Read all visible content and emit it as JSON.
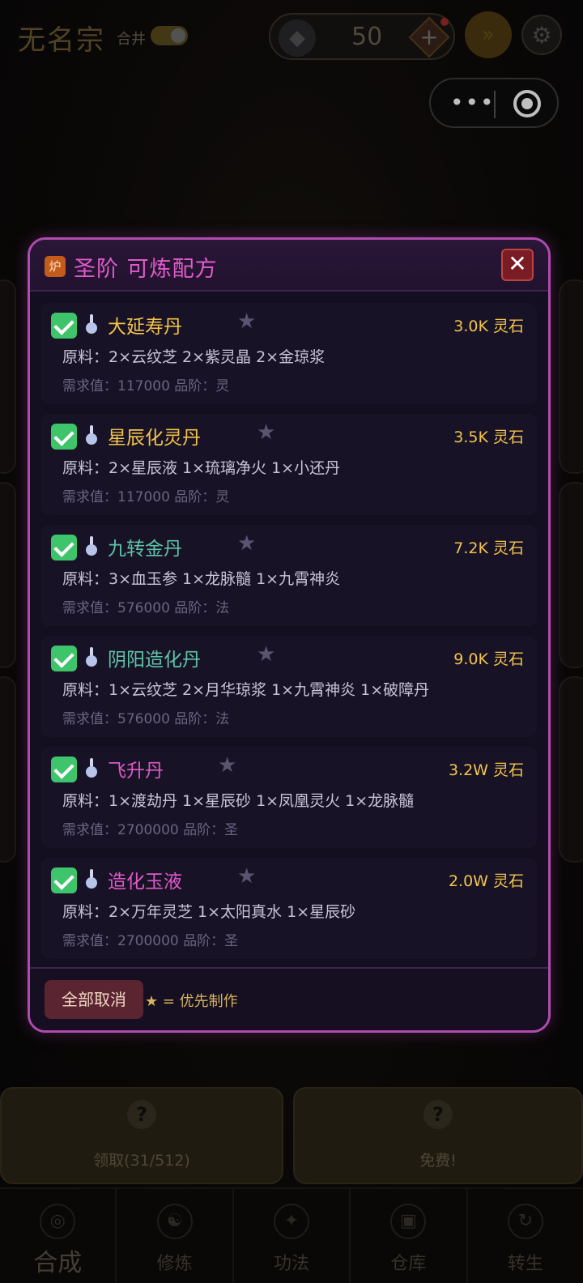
{
  "app": {
    "title": "无名宗",
    "merge_label": "合井",
    "currency_amount": "50",
    "plus_label": "+",
    "speed_icon": "»",
    "gear_icon": "⚙"
  },
  "capsule": {
    "more": "•••"
  },
  "bottom_cards": [
    {
      "label": "领取(31/512)"
    },
    {
      "label": "免费!"
    }
  ],
  "navbar": [
    {
      "label": "合成",
      "active": true
    },
    {
      "label": "修炼"
    },
    {
      "label": "功法"
    },
    {
      "label": "仓库"
    },
    {
      "label": "转生"
    }
  ],
  "modal": {
    "icon_text": "炉",
    "title": "圣阶 可炼配方",
    "close": "✕",
    "recipes": [
      {
        "name": "大延寿丹",
        "name_color": "#f2c44a",
        "price": "3.0K 灵石",
        "materials": "原料：2×云纹芝  2×紫灵晶  2×金琼浆",
        "meta": "需求值：117000  品阶：灵",
        "checked": true
      },
      {
        "name": "星辰化灵丹",
        "name_color": "#f2c44a",
        "price": "3.5K 灵石",
        "materials": "原料：2×星辰液  1×琉璃净火  1×小还丹",
        "meta": "需求值：117000  品阶：灵",
        "checked": true
      },
      {
        "name": "九转金丹",
        "name_color": "#5ec4a8",
        "price": "7.2K 灵石",
        "materials": "原料：3×血玉参  1×龙脉髓  1×九霄神炎",
        "meta": "需求值：576000  品阶：法",
        "checked": true
      },
      {
        "name": "阴阳造化丹",
        "name_color": "#5ec4a8",
        "price": "9.0K 灵石",
        "materials": "原料：1×云纹芝  2×月华琼浆  1×九霄神炎  1×破障丹",
        "meta": "需求值：576000  品阶：法",
        "checked": true
      },
      {
        "name": "飞升丹",
        "name_color": "#e05ac8",
        "price": "3.2W 灵石",
        "materials": "原料：1×渡劫丹  1×星辰砂  1×凤凰灵火  1×龙脉髓",
        "meta": "需求值：2700000  品阶：圣",
        "checked": true
      },
      {
        "name": "造化玉液",
        "name_color": "#e05ac8",
        "price": "2.0W 灵石",
        "materials": "原料：2×万年灵芝  1×太阳真水  1×星辰砂",
        "meta": "需求值：2700000  品阶：圣",
        "checked": true
      }
    ],
    "cancel_all": "全部取消",
    "legend": "★ = 优先制作"
  }
}
